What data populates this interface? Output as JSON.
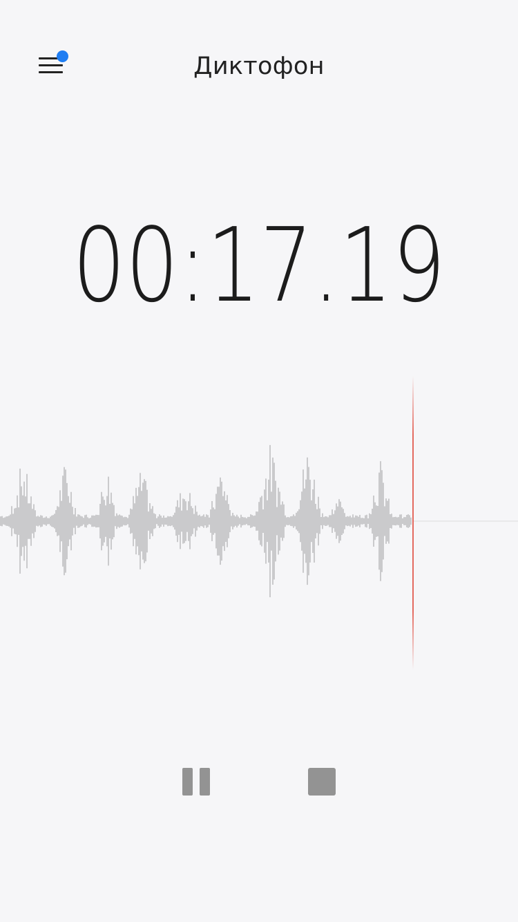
{
  "header": {
    "title": "Диктофон",
    "menu_icon": "hamburger-menu-icon",
    "notification_dot_color": "#1f7df2"
  },
  "recorder": {
    "elapsed_time": "00:17.19",
    "state": "recording",
    "playhead_color": "#e25a4e",
    "waveform_color": "#8a8a8a"
  },
  "controls": {
    "pause_icon": "pause-icon",
    "stop_icon": "stop-icon",
    "icon_color": "#939393"
  }
}
